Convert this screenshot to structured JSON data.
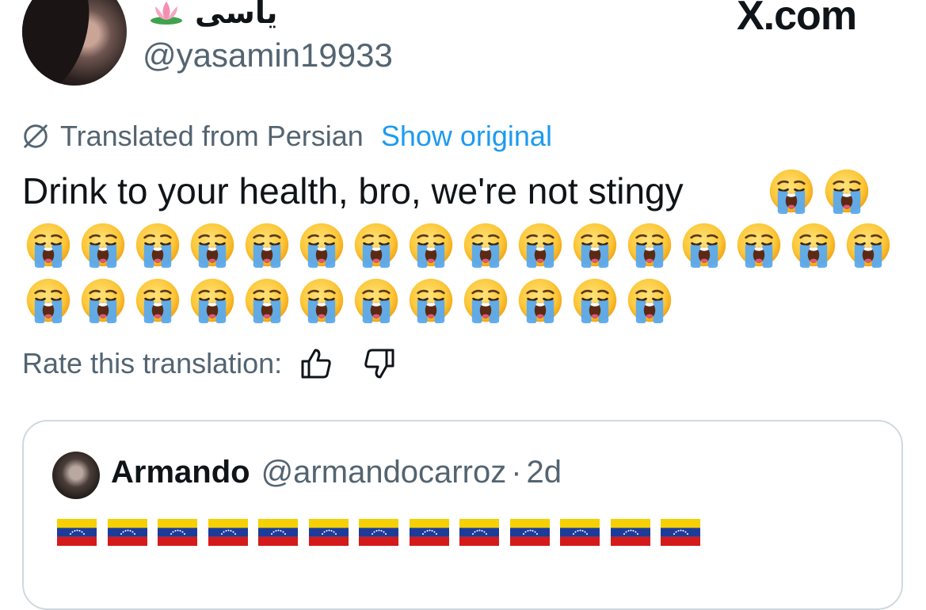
{
  "author": {
    "display_name": "یاسی",
    "handle": "@yasamin19933",
    "name_emoji_icon": "lotus-icon"
  },
  "brand": {
    "label": "X.com"
  },
  "translation": {
    "icon": "globe-slash-icon",
    "label": "Translated from Persian",
    "show_original_label": "Show original"
  },
  "tweet": {
    "text": "Drink to your health, bro, we're not stingy",
    "emoji_icon": "loudly-crying-face-icon",
    "emoji_count": 30
  },
  "rate": {
    "label": "Rate this translation:",
    "thumbs_up_icon": "thumbs-up-icon",
    "thumbs_down_icon": "thumbs-down-icon"
  },
  "quote": {
    "name": "Armando",
    "handle": "@armandocarroz",
    "separator": "·",
    "time": "2d",
    "flag_icon": "venezuela-flag-icon",
    "flag_count": 13
  },
  "colors": {
    "text": "#0f1419",
    "secondary": "#536471",
    "link": "#1d9bf0",
    "border": "#cfd9de"
  }
}
